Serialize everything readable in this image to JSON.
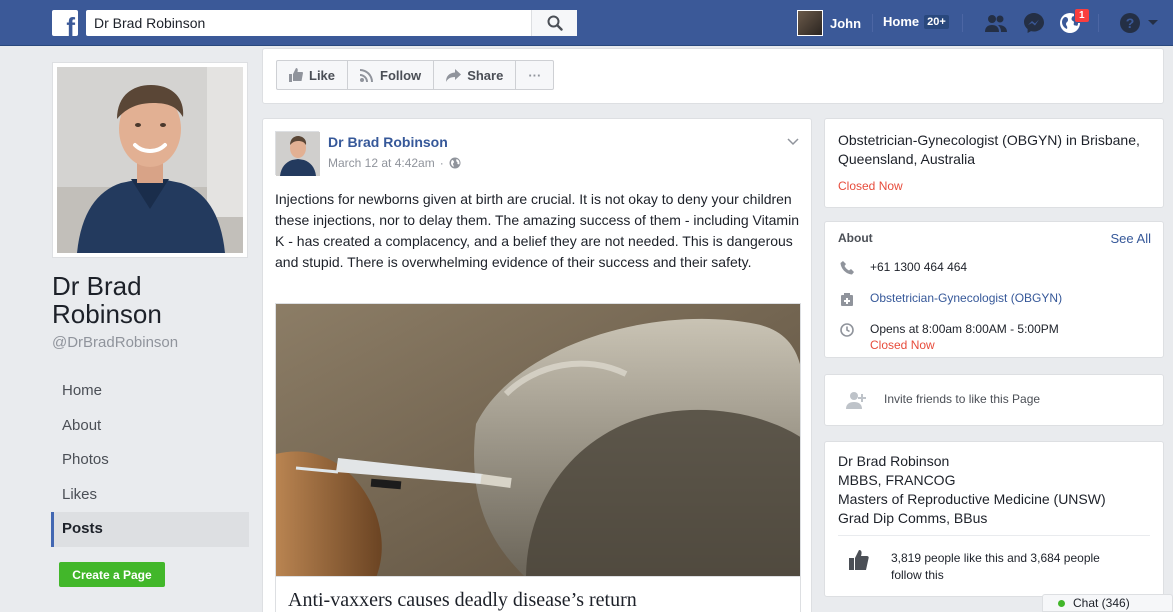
{
  "topbar": {
    "search_value": "Dr Brad Robinson",
    "user_name": "John",
    "home_label": "Home",
    "home_badge": "20+",
    "notif_count": "1"
  },
  "page": {
    "name": "Dr Brad Robinson",
    "handle": "@DrBradRobinson"
  },
  "nav": {
    "items": [
      {
        "label": "Home"
      },
      {
        "label": "About"
      },
      {
        "label": "Photos"
      },
      {
        "label": "Likes"
      },
      {
        "label": "Posts"
      }
    ],
    "active": "Posts"
  },
  "create_page_label": "Create a Page",
  "actions": {
    "like": "Like",
    "follow": "Follow",
    "share": "Share",
    "more": "···"
  },
  "post": {
    "author": "Dr Brad Robinson",
    "time": "March 12 at 4:42am",
    "time_sep": "·",
    "text": "Injections for newborns given at birth are crucial. It is not okay to deny your children these injections, nor to delay them. The amazing success of them - including Vitamin K - has created a complacency, and a belief they are not needed. This is dangerous and stupid. There is overwhelming evidence of their success and their safety.",
    "link_title": "Anti-vaxxers causes deadly disease’s return"
  },
  "category_card": {
    "category": "Obstetrician-Gynecologist (OBGYN) in Brisbane, Queensland, Australia",
    "status": "Closed Now"
  },
  "about": {
    "title": "About",
    "see_all": "See All",
    "phone": "+61 1300 464 464",
    "category": "Obstetrician-Gynecologist (OBGYN)",
    "hours": "Opens at 8:00am 8:00AM - 5:00PM",
    "hours_status": "Closed Now"
  },
  "invite": {
    "label": "Invite friends to like this Page"
  },
  "credentials": {
    "lines": [
      "Dr Brad Robinson",
      "MBBS, FRANCOG",
      "Masters of Reproductive Medicine (UNSW)",
      "Grad Dip Comms, BBus"
    ],
    "likes_text": "3,819 people like this and 3,684 people follow this"
  },
  "chat": {
    "label": "Chat (346)"
  },
  "colors": {
    "brand": "#3b5998",
    "link": "#365899",
    "closed": "#e74c3c",
    "create_button": "#42b72a"
  }
}
